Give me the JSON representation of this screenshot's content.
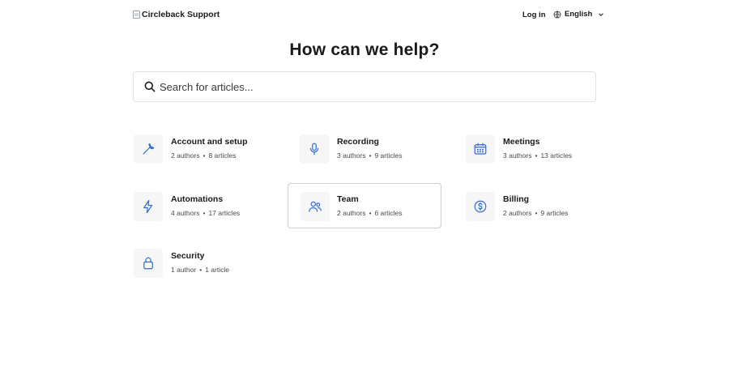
{
  "header": {
    "logo_text": "Circleback Support",
    "login_label": "Log in",
    "language_label": "English"
  },
  "hero": {
    "title": "How can we help?"
  },
  "search": {
    "placeholder": "Search for articles..."
  },
  "collections": [
    {
      "title": "Account and setup",
      "authors": "2 authors",
      "articles": "8 articles",
      "icon": "wrench-icon"
    },
    {
      "title": "Recording",
      "authors": "3 authors",
      "articles": "9 articles",
      "icon": "microphone-icon"
    },
    {
      "title": "Meetings",
      "authors": "3 authors",
      "articles": "13 articles",
      "icon": "calendar-icon"
    },
    {
      "title": "Automations",
      "authors": "4 authors",
      "articles": "17 articles",
      "icon": "lightning-icon"
    },
    {
      "title": "Team",
      "authors": "2 authors",
      "articles": "6 articles",
      "icon": "users-icon"
    },
    {
      "title": "Billing",
      "authors": "2 authors",
      "articles": "9 articles",
      "icon": "dollar-icon"
    },
    {
      "title": "Security",
      "authors": "1 author",
      "articles": "1 article",
      "icon": "lock-icon"
    }
  ],
  "colors": {
    "icon_accent": "#2f6bd8",
    "icon_bg": "#f6f6f7",
    "text": "#1a1a1a"
  }
}
